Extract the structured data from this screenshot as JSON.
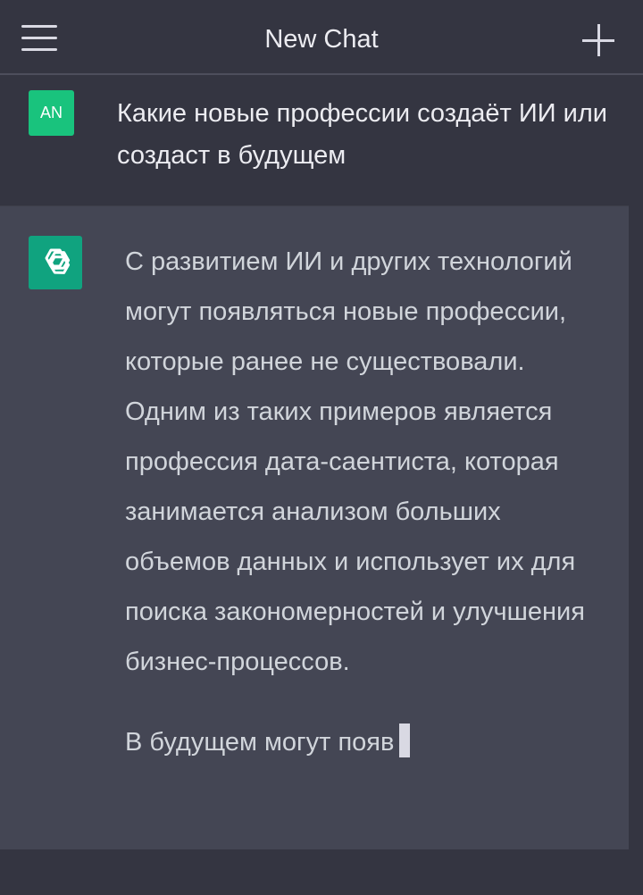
{
  "header": {
    "title": "New Chat",
    "menu_icon": "hamburger-menu-icon",
    "new_chat_icon": "plus-icon"
  },
  "user_message": {
    "avatar_initials": "AN",
    "avatar_color": "#19c37d",
    "text": "Какие новые профессии создаёт ИИ или создаст в будущем"
  },
  "assistant_message": {
    "avatar_icon": "openai-logo-icon",
    "avatar_color": "#10a37f",
    "paragraphs": [
      "С развитием ИИ и других технологий могут появляться новые профессии, которые ранее не существовали. Одним из таких примеров является профессия дата-саентиста, которая занимается анализом больших объемов данных и использует их для поиска закономерностей и улучшения бизнес-процессов.",
      "В будущем могут появ"
    ],
    "typing_cursor": true
  },
  "colors": {
    "background": "#343541",
    "assistant_background": "#444654",
    "text": "#ececf1"
  }
}
